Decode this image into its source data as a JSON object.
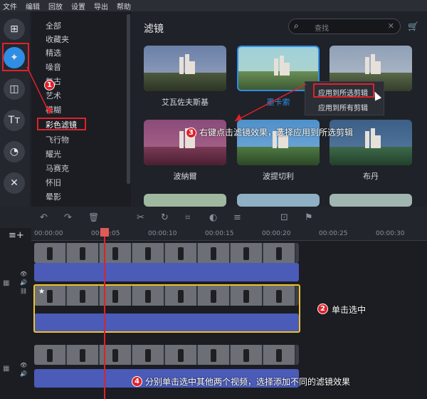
{
  "menu": [
    "文件",
    "编辑",
    "回放",
    "设置",
    "导出",
    "帮助"
  ],
  "categories": [
    "全部",
    "收藏夹",
    "精选",
    "噪音",
    "复古",
    "艺术",
    "模糊",
    "彩色滤镜",
    "飞行物",
    "耀光",
    "马赛克",
    "怀旧",
    "晕影"
  ],
  "selected_category": "彩色滤镜",
  "panel": {
    "title": "滤镜",
    "search_placeholder": "查找"
  },
  "filters": [
    {
      "label": "艾瓦佐夫斯基",
      "selected": false
    },
    {
      "label": "墨卡索",
      "selected": true
    },
    {
      "label": "",
      "selected": false
    },
    {
      "label": "波納爾",
      "selected": false
    },
    {
      "label": "波提切利",
      "selected": false
    },
    {
      "label": "布丹",
      "selected": false
    }
  ],
  "context_menu": {
    "apply_selected": "应用到所选剪辑",
    "apply_all": "应用到所有剪辑"
  },
  "annotations": {
    "step1": "1",
    "step2": "2",
    "step2_text": "单击选中",
    "step3": "3",
    "step3_text": "右键点击滤镜效果，选择应用到所选剪辑",
    "step4": "4",
    "step4_text": "分别单击选中其他两个视频，选择添加不同的滤镜效果"
  },
  "timeline": {
    "ticks": [
      "00:00:00",
      "00:00:05",
      "00:00:10",
      "00:00:15",
      "00:00:20",
      "00:00:25",
      "00:00:30"
    ]
  },
  "colors": {
    "accent": "#2f8de4",
    "annotation": "#e0212a",
    "selection": "#f2c12e",
    "audio": "#4a5bb8"
  }
}
